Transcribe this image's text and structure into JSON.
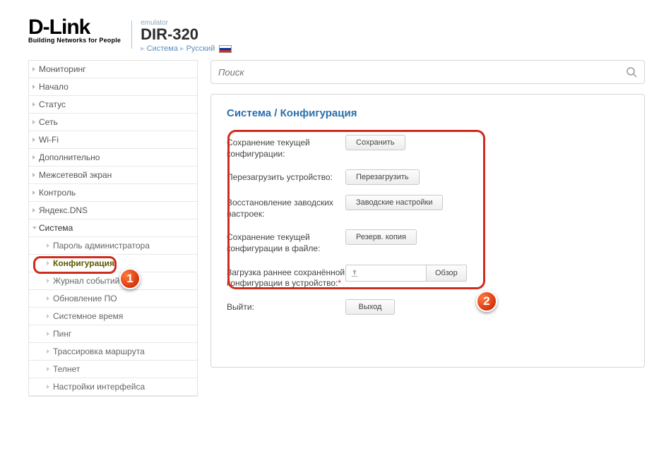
{
  "header": {
    "logo": "D-Link",
    "tagline": "Building Networks for People",
    "emulator": "emulator",
    "model": "DIR-320",
    "crumb_system": "Система",
    "crumb_lang": "Русский"
  },
  "search": {
    "placeholder": "Поиск"
  },
  "sidebar": {
    "items": [
      {
        "label": "Мониторинг"
      },
      {
        "label": "Начало"
      },
      {
        "label": "Статус"
      },
      {
        "label": "Сеть"
      },
      {
        "label": "Wi-Fi"
      },
      {
        "label": "Дополнительно"
      },
      {
        "label": "Межсетевой экран"
      },
      {
        "label": "Контроль"
      },
      {
        "label": "Яндекс.DNS"
      },
      {
        "label": "Система"
      }
    ],
    "system_children": [
      {
        "label": "Пароль администратора"
      },
      {
        "label": "Конфигурация"
      },
      {
        "label": "Журнал событий"
      },
      {
        "label": "Обновление ПО"
      },
      {
        "label": "Системное время"
      },
      {
        "label": "Пинг"
      },
      {
        "label": "Трассировка маршрута"
      },
      {
        "label": "Телнет"
      },
      {
        "label": "Настройки интерфейса"
      }
    ]
  },
  "panel": {
    "title": "Система /  Конфигурация",
    "rows": {
      "save_cfg": {
        "label": "Сохранение текущей конфигурации:",
        "button": "Сохранить"
      },
      "reboot": {
        "label": "Перезагрузить устройство:",
        "button": "Перезагрузить"
      },
      "factory": {
        "label": "Восстановление заводских настроек:",
        "button": "Заводские настройки"
      },
      "backup": {
        "label": "Сохранение текущей конфигурации в файле:",
        "button": "Резерв. копия"
      },
      "restore": {
        "label": "Загрузка раннее сохранённой конфигурации в устройство:",
        "required": "*",
        "button": "Обзор"
      },
      "logout": {
        "label": "Выйти:",
        "button": "Выход"
      }
    }
  },
  "badges": {
    "one": "1",
    "two": "2"
  }
}
